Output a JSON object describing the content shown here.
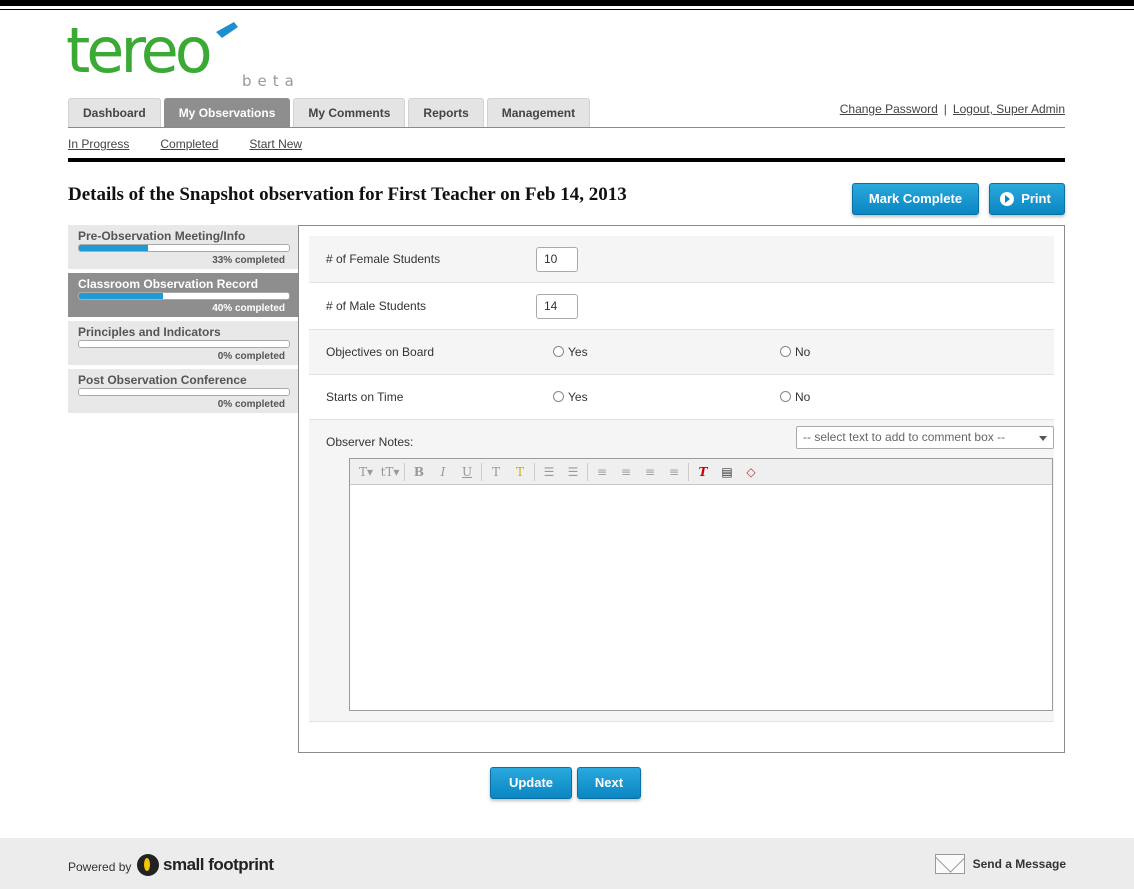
{
  "brand": {
    "logo_text": "tereo",
    "logo_tag": "beta"
  },
  "nav": {
    "tabs": [
      {
        "label": "Dashboard"
      },
      {
        "label": "My Observations",
        "active": true
      },
      {
        "label": "My Comments"
      },
      {
        "label": "Reports"
      },
      {
        "label": "Management"
      }
    ],
    "change_password": "Change Password",
    "separator": "|",
    "logout": "Logout, Super Admin",
    "subnav": [
      "In Progress",
      "Completed",
      "Start New"
    ]
  },
  "page": {
    "title": "Details of the Snapshot observation for First Teacher on Feb 14, 2013",
    "mark_complete": "Mark Complete",
    "print": "Print"
  },
  "sidebar": {
    "items": [
      {
        "label": "Pre-Observation Meeting/Info",
        "progress": 33,
        "pct_label": "33% completed"
      },
      {
        "label": "Classroom Observation Record",
        "progress": 40,
        "pct_label": "40% completed",
        "active": true
      },
      {
        "label": "Principles and Indicators",
        "progress": 0,
        "pct_label": "0% completed"
      },
      {
        "label": "Post Observation Conference",
        "progress": 0,
        "pct_label": "0% completed"
      }
    ]
  },
  "form": {
    "female_label": "# of Female Students",
    "female_value": "10",
    "male_label": "# of Male Students",
    "male_value": "14",
    "objectives_label": "Objectives on Board",
    "starts_label": "Starts on Time",
    "yes": "Yes",
    "no": "No",
    "notes_label": "Observer Notes:",
    "comment_select": "-- select text to add to comment box --"
  },
  "actions": {
    "update": "Update",
    "next": "Next"
  },
  "footer": {
    "powered_by": "Powered by",
    "brand": "small footprint",
    "send_message": "Send a Message"
  },
  "colors": {
    "accent": "#1e9ad6",
    "logo_green": "#3aaa35",
    "logo_blue": "#1c8fd0"
  },
  "icons": [
    "print-icon",
    "send-message-icon",
    "small-footprint-icon",
    "tereo-logo"
  ]
}
